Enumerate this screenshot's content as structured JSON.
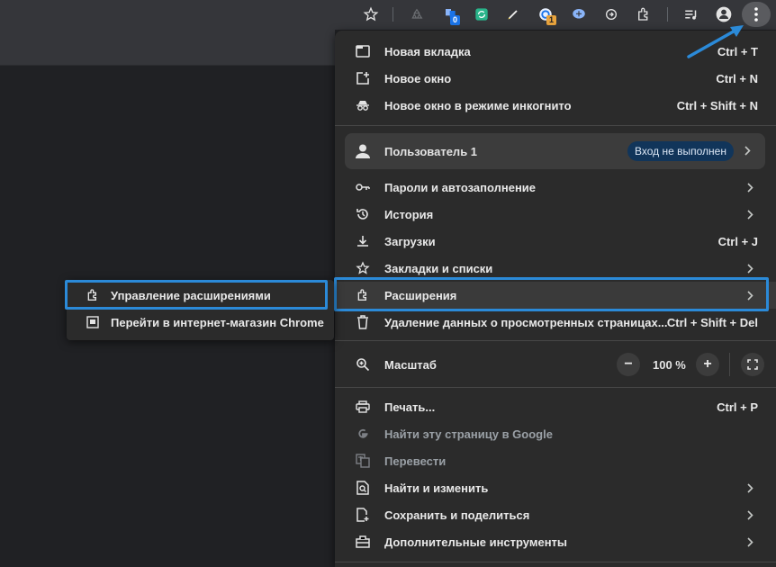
{
  "toolbar": {
    "badges": {
      "ext2": "0",
      "ext6": "1"
    },
    "icons": [
      "star-icon",
      "recycle-icon",
      "blue-extension-icon",
      "green-refresh-icon",
      "pen-icon",
      "g-translate-icon",
      "brain-icon",
      "circular-arrow-icon",
      "puzzle-icon",
      "media-queue-icon",
      "profile-icon",
      "kebab-menu-icon"
    ]
  },
  "menu": {
    "new_tab": {
      "label": "Новая вкладка",
      "shortcut": "Ctrl + T"
    },
    "new_window": {
      "label": "Новое окно",
      "shortcut": "Ctrl + N"
    },
    "incognito": {
      "label": "Новое окно в режиме инкогнито",
      "shortcut": "Ctrl + Shift + N"
    },
    "profile": {
      "label": "Пользователь 1",
      "status": "Вход не выполнен"
    },
    "passwords": {
      "label": "Пароли и автозаполнение"
    },
    "history": {
      "label": "История"
    },
    "downloads": {
      "label": "Загрузки",
      "shortcut": "Ctrl + J"
    },
    "bookmarks": {
      "label": "Закладки и списки"
    },
    "extensions": {
      "label": "Расширения"
    },
    "clear_data": {
      "label": "Удаление данных о просмотренных страницах...",
      "shortcut": "Ctrl + Shift + Del"
    },
    "zoom": {
      "label": "Масштаб",
      "minus": "−",
      "value": "100 %",
      "plus": "+"
    },
    "print": {
      "label": "Печать...",
      "shortcut": "Ctrl + P"
    },
    "search_google": {
      "label": "Найти эту страницу в Google"
    },
    "translate": {
      "label": "Перевести"
    },
    "find_edit": {
      "label": "Найти и изменить"
    },
    "save_share": {
      "label": "Сохранить и поделиться"
    },
    "more_tools": {
      "label": "Дополнительные инструменты"
    }
  },
  "submenu": {
    "manage": {
      "label": "Управление расширениями"
    },
    "store": {
      "label": "Перейти в интернет-магазин Chrome"
    }
  },
  "colors": {
    "highlight": "#2b8ad8",
    "menu_bg": "#2b2b2b",
    "pill_bg": "#11355a"
  }
}
